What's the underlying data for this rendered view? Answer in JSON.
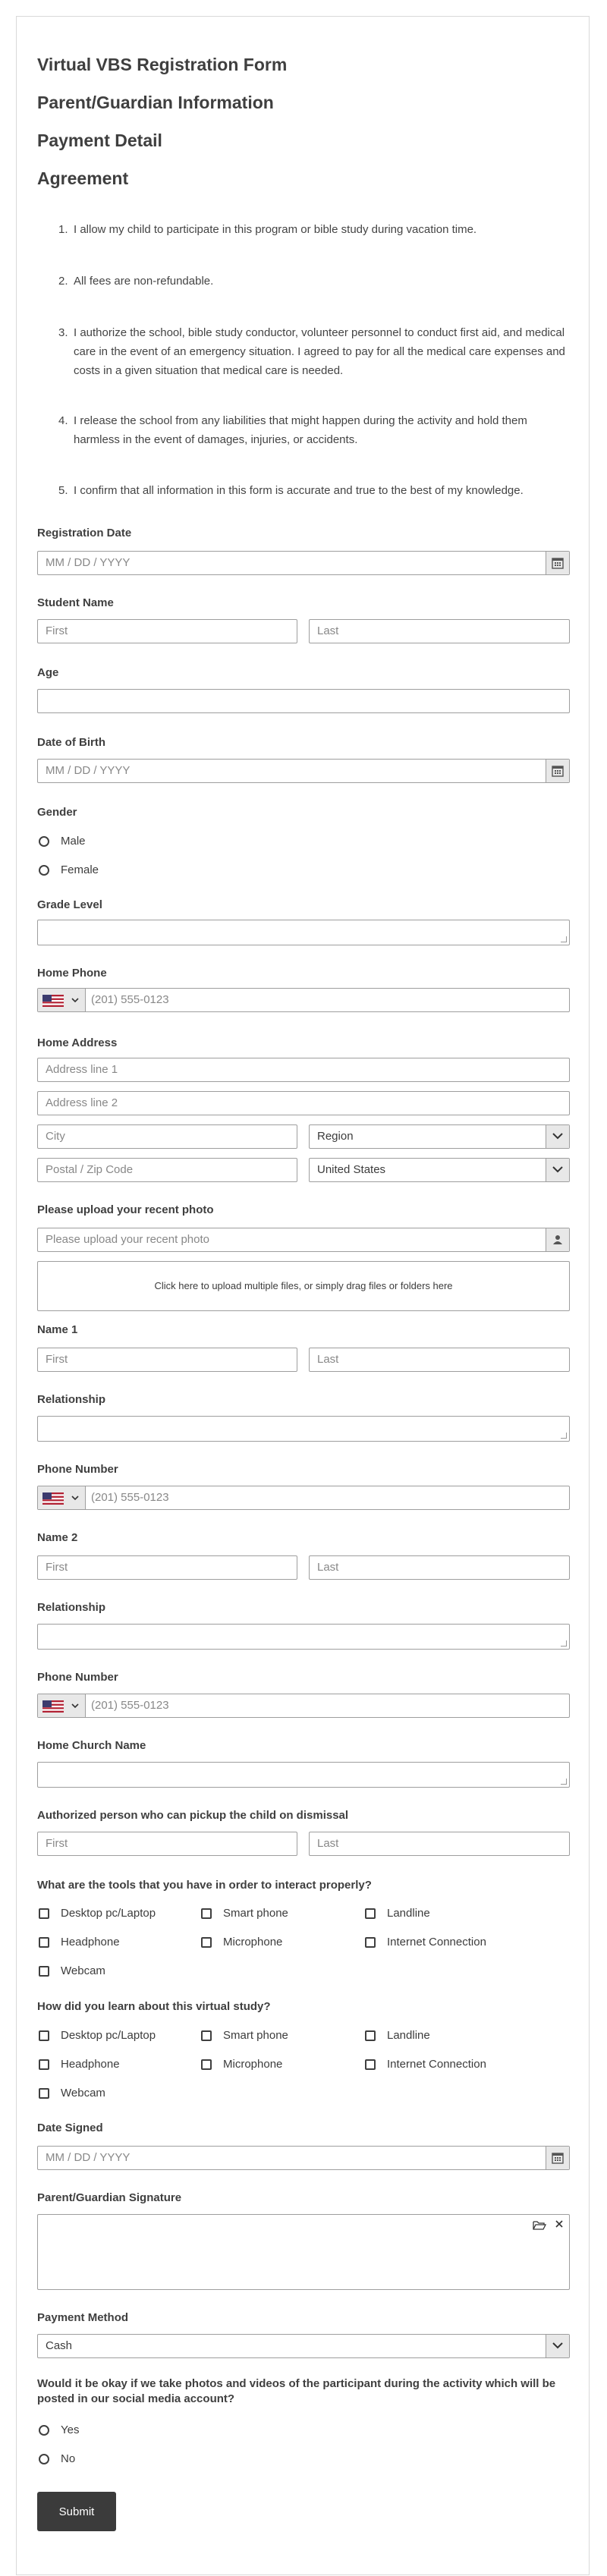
{
  "headings": {
    "h1": "Virtual VBS Registration Form",
    "h2": "Parent/Guardian Information",
    "h3": "Payment Detail",
    "h4": "Agreement"
  },
  "agreement": [
    "I allow my child to participate in this program or bible study during vacation time.",
    "All fees are non-refundable.",
    "I authorize the school, bible study conductor, volunteer personnel to conduct first aid, and medical care in the event of an emergency situation. I agreed to pay for all the medical care expenses and costs in a given situation that medical care is needed.",
    "I release the school from any liabilities that might happen during the activity and hold them harmless in the event of damages, injuries, or accidents.",
    "I confirm that all information in this form is accurate and true to the best of my knowledge."
  ],
  "agreement_nums": [
    "1.",
    "2.",
    "3.",
    "4.",
    "5."
  ],
  "labels": {
    "registration_date": "Registration Date",
    "student_name": "Student Name",
    "age": "Age",
    "dob": "Date of Birth",
    "gender": "Gender",
    "grade": "Grade Level",
    "home_phone": "Home Phone",
    "home_address": "Home Address",
    "photo": "Please upload your recent photo",
    "name1": "Name 1",
    "relationship1": "Relationship",
    "phone1": "Phone Number",
    "name2": "Name 2",
    "relationship2": "Relationship",
    "phone2": "Phone Number",
    "church": "Home Church Name",
    "pickup": "Authorized person who can pickup the child on dismissal",
    "tools": "What are the tools that you have in order to interact properly?",
    "learn": "How did you learn about this virtual study?",
    "date_signed": "Date Signed",
    "signature": "Parent/Guardian Signature",
    "payment": "Payment Method",
    "photos_q": "Would it be okay if we take photos and videos of the participant during the activity which will be posted in our social media account?"
  },
  "placeholders": {
    "date": "MM / DD / YYYY",
    "first": "First",
    "last": "Last",
    "phone": "(201) 555-0123",
    "addr1": "Address line 1",
    "addr2": "Address line 2",
    "city": "City",
    "region": "Region",
    "postal": "Postal / Zip Code",
    "country": "United States",
    "upload": "Please upload your recent photo",
    "dropzone": "Click here to upload multiple files, or simply drag files or folders here",
    "payment": "Cash"
  },
  "gender_options": [
    "Male",
    "Female"
  ],
  "tool_options": [
    "Desktop pc/Laptop",
    "Smart phone",
    "Landline",
    "Headphone",
    "Microphone",
    "Internet Connection",
    "Webcam"
  ],
  "yesno_options": [
    "Yes",
    "No"
  ],
  "submit_label": "Submit",
  "colors": {
    "accent": "#3b3b3b",
    "border": "#9e9e9e",
    "icon_bg": "#e8e8e8"
  }
}
